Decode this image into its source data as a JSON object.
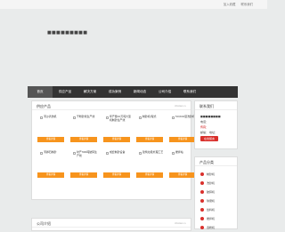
{
  "top_links": [
    "加入收藏",
    "联系我们"
  ],
  "site_name": "■■■■■■■■■",
  "nav": [
    "首页",
    "供应产品",
    "解决方案",
    "成功案例",
    "新闻动态",
    "公司介绍",
    "联系我们"
  ],
  "products_panel": {
    "title": "供应产品",
    "more": "more>>",
    "items": [
      {
        "name": "河沙清洗机",
        "button": "查看详情"
      },
      {
        "name": "干粉砂浆生产线",
        "button": "查看详情"
      },
      {
        "name": "年产量10万吨大型机制砂生产线",
        "button": "查看详情"
      },
      {
        "name": "制砂机/辊式",
        "button": "查看详情"
      },
      {
        "name": "5X/XLS型洗砂机",
        "button": "查看详情"
      },
      {
        "name": "河卵石制砂",
        "button": "查看详情"
      },
      {
        "name": "时产300吨破碎生产线",
        "button": "查看详情"
      },
      {
        "name": "成套制砂设备",
        "button": "查看详情"
      },
      {
        "name": "建筑垃圾处理工艺",
        "button": "查看详情"
      },
      {
        "name": "搅拌站",
        "button": "查看详情"
      }
    ]
  },
  "contact_panel": {
    "title": "联系我们",
    "lines": [
      "■■■■■■■■",
      "电话：",
      "传真：",
      "邮编：      地址："
    ],
    "button": "在线留言"
  },
  "category_panel": {
    "title": "产品分类",
    "items": [
      "制砂机",
      "洗砂机",
      "破碎机",
      "球磨机",
      "给料机",
      "搅拌机",
      "选粉机"
    ]
  },
  "about_panel": {
    "title": "公司介绍",
    "more": "more>>"
  }
}
